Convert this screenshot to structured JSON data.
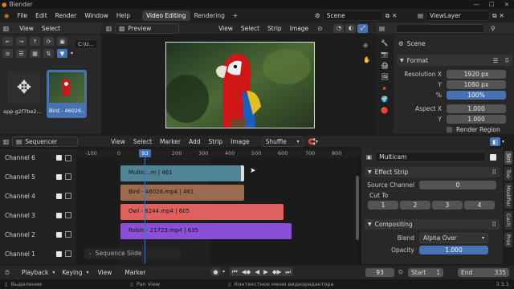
{
  "window": {
    "title": "Blender"
  },
  "menu": {
    "items": [
      "File",
      "Edit",
      "Render",
      "Window",
      "Help"
    ]
  },
  "workspace_tabs": [
    {
      "label": "Video Editing",
      "active": true
    },
    {
      "label": "Rendering",
      "active": false
    }
  ],
  "add_tab_label": "+",
  "scene": {
    "label": "Scene"
  },
  "view_layer": {
    "label": "ViewLayer"
  },
  "file_browser": {
    "menus": [
      "View",
      "Select"
    ],
    "path": "C:\\U...",
    "items": [
      {
        "name": "app-g2f7be2...",
        "icon": "move-arrows-icon",
        "selected": false
      },
      {
        "name": "Bird - 46026....",
        "icon": "parrot-thumbnail",
        "selected": true
      }
    ]
  },
  "preview": {
    "mode": "Preview",
    "menus": [
      "View",
      "Select",
      "Strip",
      "Image"
    ]
  },
  "properties_top": {
    "scene_label": "Scene",
    "section": "Format",
    "fields": [
      {
        "label": "Resolution X",
        "value": "1920 px"
      },
      {
        "label": "Y",
        "value": "1080 px"
      },
      {
        "label": "%",
        "value": "100%",
        "highlight": true
      },
      {
        "label": "Aspect X",
        "value": "1.000"
      },
      {
        "label": "Y",
        "value": "1.000"
      }
    ],
    "render_region_label": "Render Region"
  },
  "sequencer": {
    "editor_label": "Sequencer",
    "menus": [
      "View",
      "Select",
      "Marker",
      "Add",
      "Strip",
      "Image"
    ],
    "mode": "Shuffle",
    "ruler": [
      "-100",
      "0",
      "100",
      "200",
      "300",
      "400",
      "500",
      "600",
      "700",
      "800",
      "900"
    ],
    "current_frame": "93",
    "channels": [
      "Channel 6",
      "Channel 5",
      "Channel 4",
      "Channel 3",
      "Channel 2",
      "Channel 1"
    ],
    "strips": [
      {
        "label": "Multic...m | 461",
        "channel": 5,
        "start": 0,
        "end": 461,
        "color": "#4f8396"
      },
      {
        "label": "Bird - 46026.mp4 | 461",
        "channel": 4,
        "start": 0,
        "end": 461,
        "color": "#9c6b4f"
      },
      {
        "label": "Owl - 8244.mp4 | 605",
        "channel": 3,
        "start": 0,
        "end": 605,
        "color": "#e0605e"
      },
      {
        "label": "Robin - 21723.mp4 | 635",
        "channel": 2,
        "start": 0,
        "end": 635,
        "color": "#8a4fd6"
      }
    ],
    "slide_label": "Sequence Slide"
  },
  "strip_props": {
    "strip_name": "Multicam",
    "effect_section": "Effect Strip",
    "source_channel_label": "Source Channel",
    "source_channel_value": "0",
    "cut_to_label": "Cut To",
    "cut_buttons": [
      "1",
      "2",
      "3",
      "4"
    ],
    "compositing_section": "Compositing",
    "blend_label": "Blend",
    "blend_value": "Alpha Over",
    "opacity_label": "Opacity",
    "opacity_value": "1.000",
    "side_tabs": [
      "Stri",
      "Too",
      "Modifier",
      "Cach",
      "Prox"
    ]
  },
  "timeline": {
    "menus": [
      "Playback",
      "Keying",
      "View",
      "Marker"
    ],
    "frame": "93",
    "start_label": "Start",
    "start_value": "1",
    "end_label": "End",
    "end_value": "335"
  },
  "status": {
    "left": "Выделение",
    "middle": "Pan View",
    "right": "Контекстное меню видеоредактора",
    "version": "3.3.1"
  }
}
